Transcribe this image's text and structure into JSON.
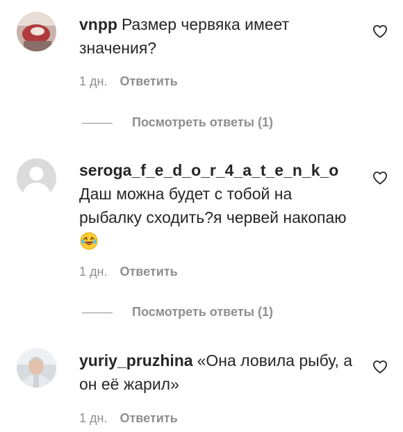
{
  "comments": [
    {
      "username": "vnpp",
      "text": "Размер червяка имеет значения?",
      "time": "1 дн.",
      "reply_label": "Ответить",
      "replies_label": "Посмотреть ответы (1)",
      "avatar_icon": "user-photo-avatar"
    },
    {
      "username": "seroga_f_e_d_o_r_4_a_t_e_n_k_o",
      "text": "Даш можна будет с тобой на рыбалку сходить?я червей накопаю",
      "emoji": "laughing-tears-emoji",
      "time": "1 дн.",
      "reply_label": "Ответить",
      "replies_label": "Посмотреть ответы (1)",
      "avatar_icon": "default-avatar"
    },
    {
      "username": "yuriy_pruzhina",
      "text": "«Она ловила рыбу, а он её жарил»",
      "time": "1 дн.",
      "reply_label": "Ответить",
      "avatar_icon": "user-photo-avatar"
    }
  ],
  "icons": {
    "like": "heart-icon"
  },
  "colors": {
    "text": "#262626",
    "secondary": "#8e8e8e",
    "background": "#ffffff"
  }
}
